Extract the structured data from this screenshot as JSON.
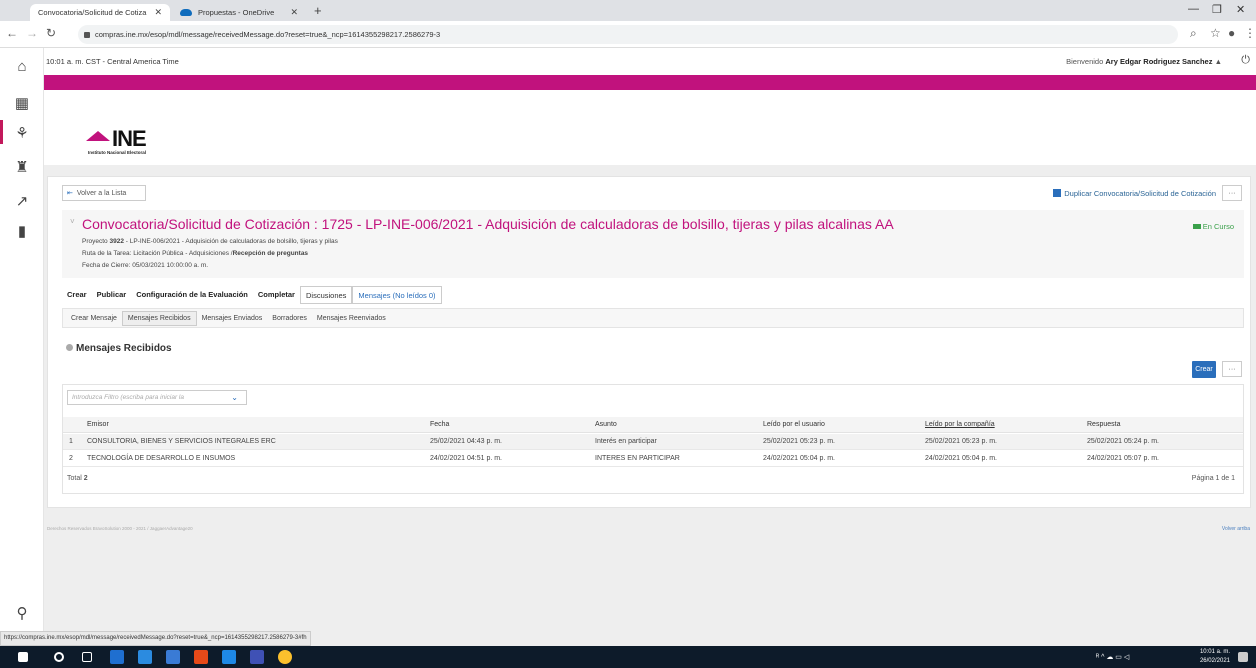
{
  "browser": {
    "tabs": [
      {
        "label": "Convocatoria/Solicitud de Cotiza"
      },
      {
        "label": "Propuestas - OneDrive"
      }
    ],
    "url": "compras.ine.mx/esop/mdl/message/receivedMessage.do?reset=true&_ncp=1614355298217.2586279-3"
  },
  "topbar": {
    "time": "10:01 a. m. CST - Central America Time",
    "welcome_prefix": "Bienvenido",
    "user": "Ary Edgar Rodriguez Sanchez"
  },
  "logo": {
    "word": "INE",
    "subtitle": "Instituto Nacional Electoral"
  },
  "toolbar": {
    "back_label": "Volver a la Lista",
    "duplicate_label": "Duplicar Convocatoria/Solicitud de Cotización",
    "more_label": "···"
  },
  "event": {
    "title": "Convocatoria/Solicitud de Cotización : 1725 - LP-INE-006/2021 - Adquisición de calculadoras de bolsillo, tijeras y pilas alcalinas AA",
    "project_prefix": "Proyecto",
    "project_code": "3922",
    "project_rest": "- LP-INE-006/2021 - Adquisición de calculadoras de bolsillo, tijeras y pilas",
    "route_prefix": "Ruta de la Tarea: Licitación Pública - Adquisiciones /",
    "route_current": "Recepción de preguntas",
    "close_date": "Fecha de Cierre: 05/03/2021 10:00:00 a. m.",
    "status": "En Curso"
  },
  "main_tabs": [
    "Crear",
    "Publicar",
    "Configuración de la Evaluación",
    "Completar",
    "Discusiones",
    "Mensajes (No leídos 0)"
  ],
  "sub_tabs": [
    "Crear Mensaje",
    "Mensajes Recibidos",
    "Mensajes Enviados",
    "Borradores",
    "Mensajes Reenviados"
  ],
  "section": {
    "title": "Mensajes Recibidos",
    "create_label": "Crear"
  },
  "filter": {
    "placeholder": "Introduzca Filtro (escriba para iniciar la"
  },
  "table": {
    "columns": [
      "Emisor",
      "Fecha",
      "Asunto",
      "Leído por el usuario",
      "Leído por la compañía",
      "Respuesta"
    ],
    "rows": [
      {
        "num": "1",
        "emisor": "CONSULTORIA, BIENES Y SERVICIOS INTEGRALES ERC",
        "fecha": "25/02/2021 04:43 p. m.",
        "asunto": "Interés en participar",
        "leido_usuario": "25/02/2021 05:23 p. m.",
        "leido_compania": "25/02/2021 05:23 p. m.",
        "respuesta": "25/02/2021 05:24 p. m."
      },
      {
        "num": "2",
        "emisor": "TECNOLOGÍA DE DESARROLLO E INSUMOS",
        "fecha": "24/02/2021 04:51 p. m.",
        "asunto": "INTERES EN PARTICIPAR",
        "leido_usuario": "24/02/2021 05:04 p. m.",
        "leido_compania": "24/02/2021 05:04 p. m.",
        "respuesta": "24/02/2021 05:07 p. m."
      }
    ],
    "total_label": "Total",
    "total_value": "2",
    "page_label": "Página 1 de 1"
  },
  "footer": {
    "left": "Derechos Reservados BravoSolution 2000 - 2021 / JaggaerAdvantage20",
    "right": "Volver arriba"
  },
  "status_url": "https://compras.ine.mx/esop/mdl/message/receivedMessage.do?reset=true&_ncp=1614355298217.2586279-3#fh",
  "taskbar": {
    "time": "10:01 a. m.",
    "date": "26/02/2021"
  },
  "colors": {
    "brand": "#c1127d",
    "primary": "#2a6ebb",
    "status_ok": "#3aa04a"
  }
}
